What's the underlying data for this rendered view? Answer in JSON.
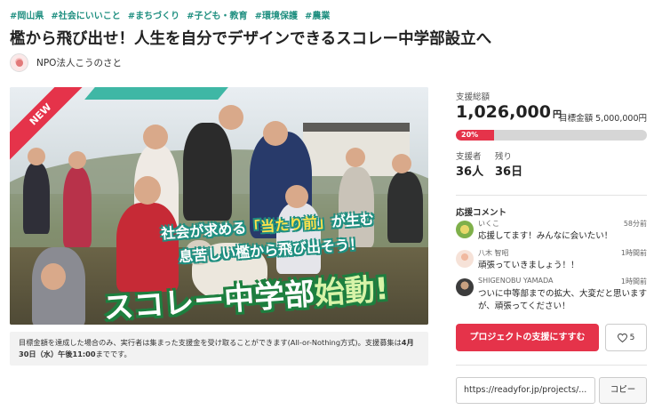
{
  "tags": [
    "#岡山県",
    "#社会にいいこと",
    "#まちづくり",
    "#子ども・教育",
    "#環境保護",
    "#農業"
  ],
  "title": "檻から飛び出せ！人生を自分でデザインできるスコレー中学部設立へ",
  "owner": {
    "name": "NPO法人こうのさと",
    "avatar_icon": "organization-logo-icon"
  },
  "hero": {
    "badge": "NEW",
    "slogan_line1_a": "社会が求める",
    "slogan_line1_b": "「当たり前」",
    "slogan_line1_c": "が生む",
    "slogan_line2": "息苦しい檻から飛び出そう！",
    "slogan_line3_a": "スコレー中学部",
    "slogan_line3_b": "始動!"
  },
  "notice": {
    "text": "目標金額を達成した場合のみ、実行者は集まった支援金を受け取ることができます(All-or-Nothing方式)。支援募集は",
    "deadline": "4月30日（水）午後11:00",
    "tail": "までです。"
  },
  "stats": {
    "total_label": "支援総額",
    "total_value": "1,026,000",
    "currency_unit": "円",
    "goal_label": "目標金額",
    "goal_value": "5,000,000円",
    "progress_percent": 20,
    "progress_text": "20%",
    "supporters_label": "支援者",
    "supporters_value": "36人",
    "remaining_label": "残り",
    "remaining_value": "36日"
  },
  "comments": {
    "title": "応援コメント",
    "items": [
      {
        "name": "いくこ",
        "time": "58分前",
        "text": "応援してます！みんなに会いたい！"
      },
      {
        "name": "八木 智昭",
        "time": "1時間前",
        "text": "頑張っていきましょう！！"
      },
      {
        "name": "SHIGENOBU YAMADA",
        "time": "1時間前",
        "text": "ついに中等部までの拡大、大変だと思いますが、頑張ってください！"
      }
    ]
  },
  "actions": {
    "support_button": "プロジェクトの支援にすすむ",
    "favorite_count": "5",
    "share_url": "https://readyfor.jp/projects/...",
    "copy_button": "コピー"
  },
  "colors": {
    "accent": "#e5334a",
    "tag": "#1f8f80"
  }
}
